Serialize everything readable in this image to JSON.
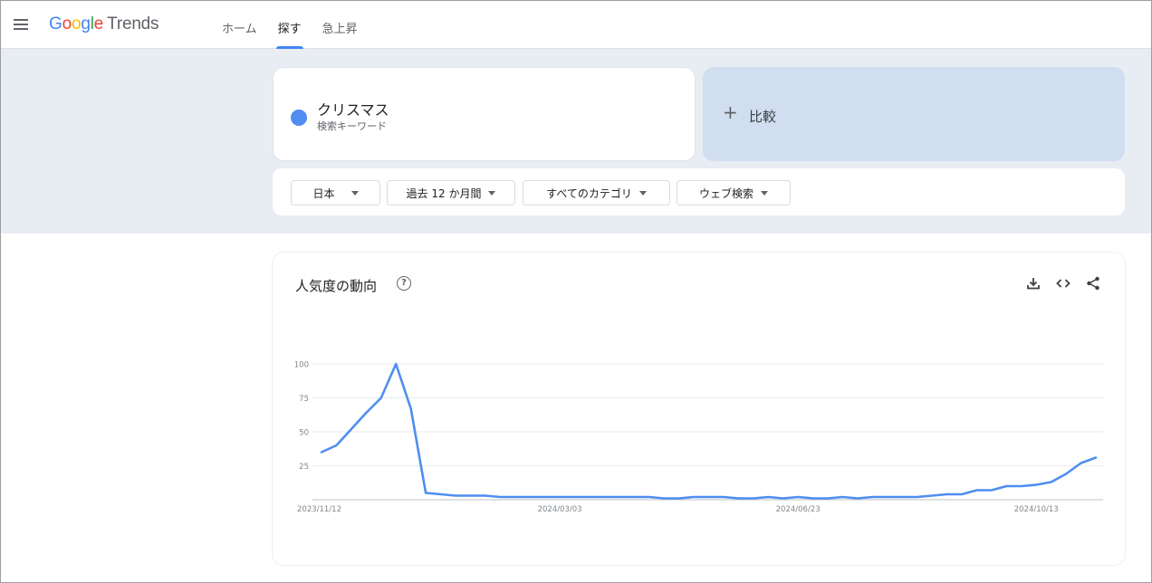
{
  "header": {
    "logo": {
      "g": "G",
      "o1": "o",
      "o2": "o",
      "g2": "g",
      "l": "l",
      "e": "e",
      "product": "Trends"
    },
    "tabs": [
      {
        "label": "ホーム"
      },
      {
        "label": "探す",
        "active": true
      },
      {
        "label": "急上昇"
      }
    ]
  },
  "search": {
    "term": "クリスマス",
    "term_type": "検索キーワード",
    "term_color": "#4f8ef0",
    "compare_label": "比較",
    "compare_plus": "+"
  },
  "filters": {
    "region": "日本",
    "time": "過去 12 か月間",
    "category": "すべてのカテゴリ",
    "property": "ウェブ検索"
  },
  "chart": {
    "title": "人気度の動向",
    "help": "?"
  },
  "chart_data": {
    "type": "line",
    "title": "人気度の動向",
    "xlabel": "",
    "ylabel": "",
    "ylim": [
      0,
      100
    ],
    "yticks": [
      25,
      50,
      75,
      100
    ],
    "grid": true,
    "legend": "none",
    "x_tick_labels": [
      "2023/11/12",
      "2024/03/03",
      "2024/06/23",
      "2024/10/13"
    ],
    "x_tick_index": [
      0,
      16,
      32,
      48
    ],
    "series": [
      {
        "color": "#4f8ef0",
        "values": [
          35,
          40,
          52,
          64,
          75,
          100,
          67,
          5,
          4,
          3,
          3,
          3,
          2,
          2,
          2,
          2,
          2,
          2,
          2,
          2,
          2,
          2,
          2,
          1,
          1,
          2,
          2,
          2,
          1,
          1,
          2,
          1,
          2,
          1,
          1,
          2,
          1,
          2,
          2,
          2,
          2,
          3,
          4,
          4,
          7,
          7,
          10,
          10,
          11,
          13,
          19,
          27,
          31
        ]
      }
    ]
  }
}
